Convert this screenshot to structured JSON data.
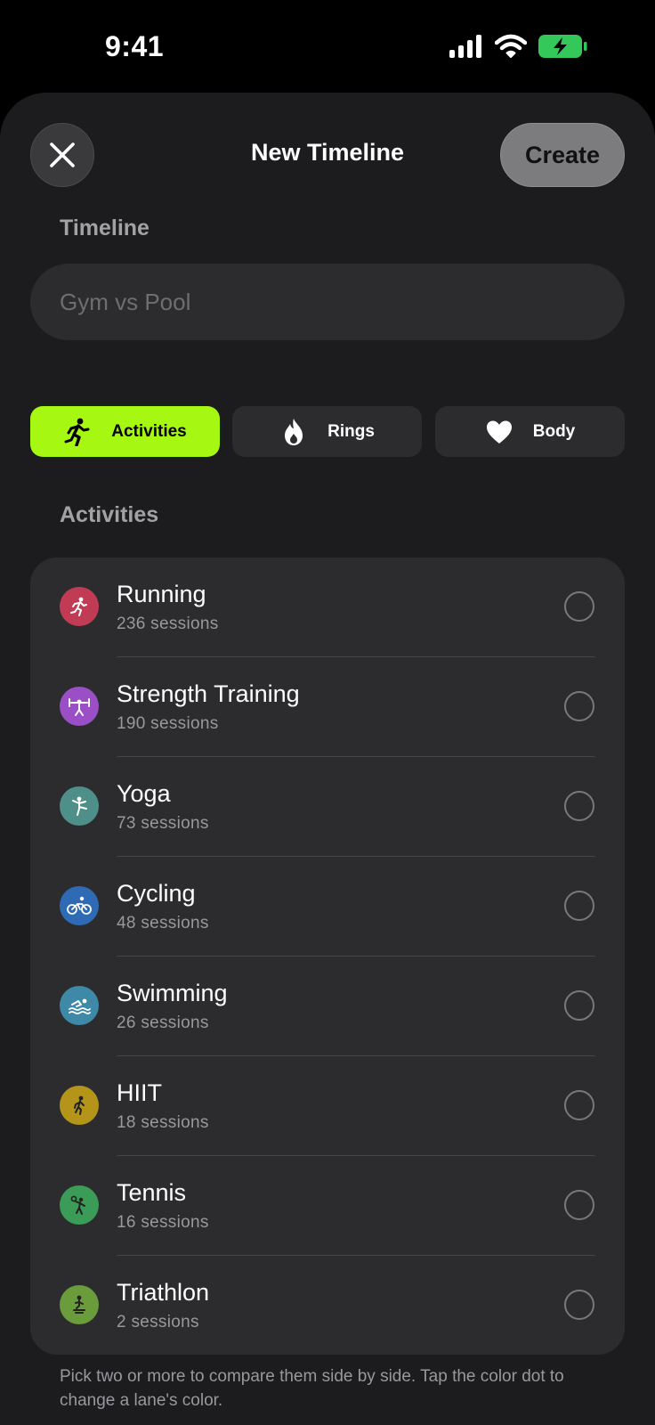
{
  "status": {
    "time": "9:41"
  },
  "header": {
    "title": "New Timeline",
    "create_label": "Create"
  },
  "timeline": {
    "label": "Timeline",
    "placeholder": "Gym vs Pool"
  },
  "tabs": [
    {
      "label": "Activities",
      "icon": "figure-run-icon",
      "active": true
    },
    {
      "label": "Rings",
      "icon": "flame-icon",
      "active": false
    },
    {
      "label": "Body",
      "icon": "heart-icon",
      "active": false
    }
  ],
  "activities": {
    "label": "Activities",
    "items": [
      {
        "name": "Running",
        "count": "236 sessions",
        "color": "#c23b55",
        "icon": "running-icon"
      },
      {
        "name": "Strength Training",
        "count": "190 sessions",
        "color": "#9b4fc6",
        "icon": "strength-icon"
      },
      {
        "name": "Yoga",
        "count": "73 sessions",
        "color": "#4e8f8a",
        "icon": "yoga-icon"
      },
      {
        "name": "Cycling",
        "count": "48 sessions",
        "color": "#2f6bb5",
        "icon": "cycling-icon"
      },
      {
        "name": "Swimming",
        "count": "26 sessions",
        "color": "#3e88a8",
        "icon": "swimming-icon"
      },
      {
        "name": "HIIT",
        "count": "18 sessions",
        "color": "#b49519",
        "icon": "hiit-icon"
      },
      {
        "name": "Tennis",
        "count": "16 sessions",
        "color": "#3a9c56",
        "icon": "tennis-icon"
      },
      {
        "name": "Triathlon",
        "count": "2 sessions",
        "color": "#6a9c3c",
        "icon": "triathlon-icon"
      }
    ]
  },
  "footer": {
    "note": "Pick two or more to compare them side by side. Tap the color dot to change a lane's color."
  },
  "colors": {
    "accent": "#a6f813",
    "background": "#1c1c1e",
    "card": "#2c2c2e"
  }
}
